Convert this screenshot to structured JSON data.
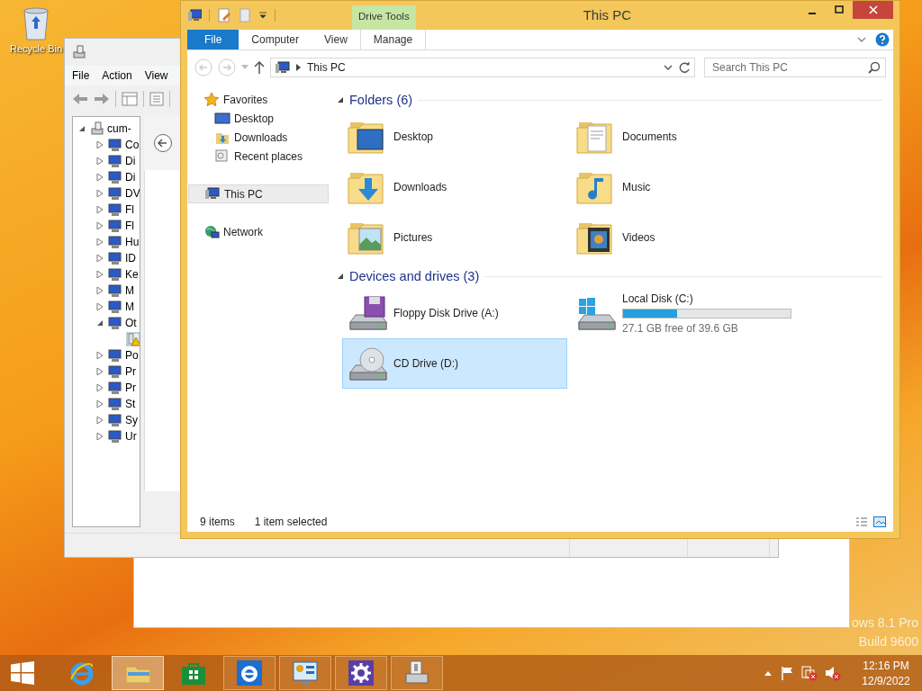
{
  "desktop": {
    "icons": [
      {
        "label": "Recycle Bin"
      }
    ],
    "watermark": [
      "ows 8.1 Pro",
      "Build 9600"
    ]
  },
  "device_manager": {
    "menu": [
      "File",
      "Action",
      "View"
    ],
    "tree": [
      {
        "label": "cum-",
        "expanded": true,
        "children": [
          {
            "label": "Co",
            "expanded": false
          },
          {
            "label": "Di",
            "expanded": false
          },
          {
            "label": "Di",
            "expanded": false
          },
          {
            "label": "DV",
            "expanded": false
          },
          {
            "label": "Fl",
            "expanded": false
          },
          {
            "label": "Fl",
            "expanded": false
          },
          {
            "label": "Hu",
            "expanded": false
          },
          {
            "label": "ID",
            "expanded": false
          },
          {
            "label": "Ke",
            "expanded": false
          },
          {
            "label": "M",
            "expanded": false
          },
          {
            "label": "M",
            "expanded": false
          },
          {
            "label": "Ot",
            "expanded": true,
            "children": [
              {
                "warning": true
              }
            ]
          },
          {
            "label": "Po",
            "expanded": false
          },
          {
            "label": "Pr",
            "expanded": false
          },
          {
            "label": "Pr",
            "expanded": false
          },
          {
            "label": "St",
            "expanded": false
          },
          {
            "label": "Sy",
            "expanded": false
          },
          {
            "label": "Ur",
            "expanded": false
          }
        ]
      }
    ]
  },
  "explorer": {
    "title": "This PC",
    "contextual_tab": "Drive Tools",
    "tabs": [
      {
        "label": "File",
        "kind": "file",
        "selected": false
      },
      {
        "label": "Computer",
        "kind": "tab",
        "selected": false
      },
      {
        "label": "View",
        "kind": "tab",
        "selected": false
      },
      {
        "label": "Manage",
        "kind": "context",
        "selected": false
      }
    ],
    "address": "This PC",
    "search": {
      "placeholder": "Search This PC"
    },
    "nav": [
      {
        "label": "Favorites",
        "kind": "star",
        "selected": false,
        "children": [
          {
            "label": "Desktop",
            "kind": "desktop",
            "selected": false
          },
          {
            "label": "Downloads",
            "kind": "downloads",
            "selected": false
          },
          {
            "label": "Recent places",
            "kind": "recent",
            "selected": false
          }
        ]
      },
      {
        "label": "This PC",
        "kind": "pc",
        "selected": true
      },
      {
        "label": "Network",
        "kind": "network",
        "selected": false
      }
    ],
    "groups": [
      {
        "title": "Folders (6)",
        "expanded": true,
        "items": [
          {
            "name": "Desktop",
            "kind": "desktop",
            "selected": false
          },
          {
            "name": "Documents",
            "kind": "documents",
            "selected": false
          },
          {
            "name": "Downloads",
            "kind": "downloads",
            "selected": false
          },
          {
            "name": "Music",
            "kind": "music",
            "selected": false
          },
          {
            "name": "Pictures",
            "kind": "pictures",
            "selected": false
          },
          {
            "name": "Videos",
            "kind": "videos",
            "selected": false
          }
        ]
      },
      {
        "title": "Devices and drives (3)",
        "expanded": true,
        "items": [
          {
            "name": "Floppy Disk Drive (A:)",
            "kind": "floppy",
            "selected": false
          },
          {
            "name": "Local Disk (C:)",
            "kind": "disk",
            "selected": false,
            "level": 0.32,
            "detail": "27.1 GB free of 39.6 GB"
          },
          {
            "name": "CD Drive (D:)",
            "kind": "cd",
            "selected": true
          }
        ]
      }
    ],
    "status": [
      "9 items",
      "1 item selected"
    ]
  },
  "taskbar": {
    "apps": [
      {
        "kind": "ie",
        "running": false,
        "active": false
      },
      {
        "kind": "explorer",
        "running": true,
        "active": true
      },
      {
        "kind": "store",
        "running": false,
        "active": false
      },
      {
        "kind": "ie-tile",
        "running": true,
        "active": false
      },
      {
        "kind": "control",
        "running": true,
        "active": false
      },
      {
        "kind": "settings",
        "running": true,
        "active": false
      },
      {
        "kind": "devmgr",
        "running": true,
        "active": false
      }
    ],
    "clock": {
      "time": "12:16 PM",
      "date": "12/9/2022"
    }
  }
}
